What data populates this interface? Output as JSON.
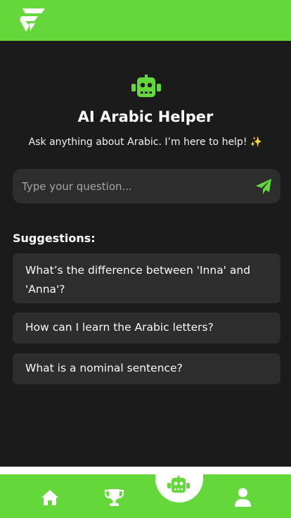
{
  "colors": {
    "accent": "#64d73a",
    "background": "#1b1b1b",
    "card": "#2d2d2d"
  },
  "header": {
    "logo_icon": "app-logo-icon"
  },
  "hero": {
    "icon": "robot-icon",
    "title": "AI Arabic Helper",
    "subtitle": "Ask anything about Arabic. I’m here to help!",
    "subtitle_emoji": "✨"
  },
  "search": {
    "placeholder": "Type your question...",
    "value": "",
    "send_icon": "send-icon"
  },
  "suggestions": {
    "heading": "Suggestions:",
    "items": [
      "What’s the difference between 'Inna' and 'Anna'?",
      "How can I learn the Arabic letters?",
      "What is a nominal sentence?"
    ]
  },
  "bottom_nav": {
    "items": [
      {
        "icon": "home-icon"
      },
      {
        "icon": "trophy-icon"
      },
      {
        "icon": "robot-icon",
        "active": true
      },
      {
        "icon": "profile-icon"
      }
    ]
  }
}
